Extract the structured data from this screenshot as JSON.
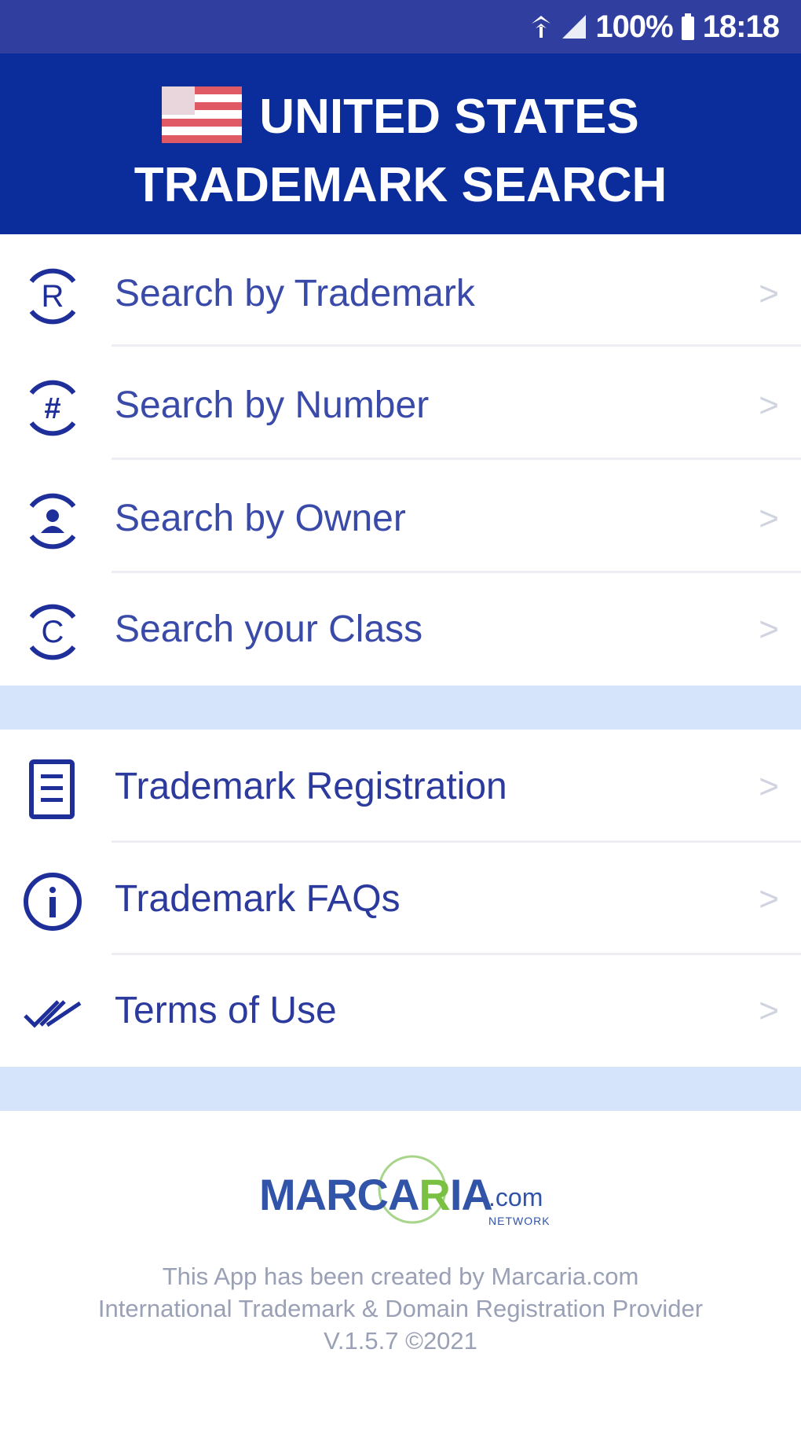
{
  "status_bar": {
    "battery": "100%",
    "time": "18:18"
  },
  "header": {
    "line1": "UNITED STATES",
    "line2": "TRADEMARK SEARCH"
  },
  "menu_group_1": [
    {
      "label": "Search by Trademark",
      "icon": "registered-icon",
      "chevron": ">"
    },
    {
      "label": "Search by Number",
      "icon": "hash-icon",
      "chevron": ">"
    },
    {
      "label": "Search by Owner",
      "icon": "owner-icon",
      "chevron": ">"
    },
    {
      "label": "Search your Class",
      "icon": "copyright-icon",
      "chevron": ">"
    }
  ],
  "menu_group_2": [
    {
      "label": "Trademark Registration",
      "icon": "document-icon",
      "chevron": ">"
    },
    {
      "label": "Trademark FAQs",
      "icon": "info-icon",
      "chevron": ">"
    },
    {
      "label": "Terms of Use",
      "icon": "double-check-icon",
      "chevron": ">"
    }
  ],
  "footer": {
    "logo_main_left": "MARCA",
    "logo_main_r": "R",
    "logo_main_right": "IA",
    "logo_suffix": ".com",
    "logo_network": "NETWORK",
    "line1": "This App has been created by Marcaria.com",
    "line2": "International Trademark & Domain Registration Provider",
    "line3": "V.1.5.7 ©2021"
  },
  "colors": {
    "status_bar": "#303f9f",
    "header": "#0b2d9b",
    "label": "#2b3a9c",
    "band": "#d6e4fb",
    "logo_blue": "#3154a9",
    "logo_green": "#7ac043"
  }
}
